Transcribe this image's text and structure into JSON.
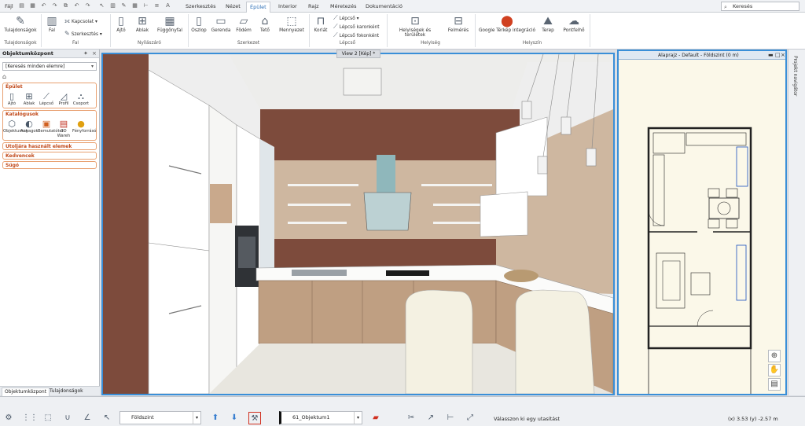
{
  "quick_access": {
    "file_label": "Fájl"
  },
  "tabs": [
    "Szerkesztés",
    "Nézet",
    "Épület",
    "Interior",
    "Rajz",
    "Méretezés",
    "Dokumentáció"
  ],
  "active_tab": "Épület",
  "search": {
    "placeholder": "Keresés"
  },
  "ribbon": {
    "tulajdonsagok": "Tulajdonságok",
    "fal": "Fal",
    "kapcsolat": "Kapcsolat",
    "szerkesztes": "Szerkesztés",
    "ajto": "Ajtó",
    "ablak": "Ablak",
    "fuggonyfal": "Függönyfal",
    "oszlop": "Oszlop",
    "gerenda": "Gerenda",
    "fodem": "Födém",
    "teto": "Tető",
    "mennyezet": "Mennyezet",
    "korlat": "Korlát",
    "lepcso": "Lépcső",
    "lepcso_karonkent": "Lépcső karonként",
    "lepcso_fokonkent": "Lépcső fokonként",
    "helyisegek": "Helyiségek és területek",
    "felmeres": "Felmérés",
    "google": "Google Térkép integráció",
    "terep": "Terep",
    "pontfelho": "Pontfelhő",
    "groups": {
      "tulajdonsagok": "Tulajdonságok",
      "fal": "Fal",
      "nyilaszaro": "Nyílászáró",
      "szerkezet": "Szerkezet",
      "lepcso": "Lépcső",
      "helyiseg": "Helyiség",
      "helyszin": "Helyszín"
    }
  },
  "left_panel": {
    "title": "Objektumközpont",
    "search_text": "[Keresés minden elemre]",
    "sections": {
      "epulet": {
        "title": "Épület",
        "items": [
          "Ajtó",
          "Ablak",
          "Lépcső",
          "Profil",
          "Csoport"
        ]
      },
      "katalogusok": {
        "title": "Katalógusok",
        "items": [
          "Objektumok",
          "Anyagok",
          "Bemutatóter",
          "3D Wareh",
          "Fényforrásó"
        ]
      }
    },
    "collapsed": [
      "Utoljára használt elemek",
      "Kedvencek",
      "Súgó"
    ],
    "bottom_tabs": [
      "Objektumközpont",
      "Tulajdonságok"
    ]
  },
  "view3d": {
    "tab_label": "View 2 [Kép] *"
  },
  "floorplan": {
    "title": "Alaprajz - Default - Földszint (0 m)"
  },
  "right_panel": {
    "label": "Projekt navigátor"
  },
  "status": {
    "floor": "Földszint",
    "layer": "61_Objektum1",
    "prompt": "Válasszon ki egy utasítást",
    "coords": "(x) 3.53   (y) -2.57 m"
  },
  "colors": {
    "accent": "#3a8fd8",
    "section_title": "#c04818",
    "wall_brown": "#7d4b3c"
  }
}
